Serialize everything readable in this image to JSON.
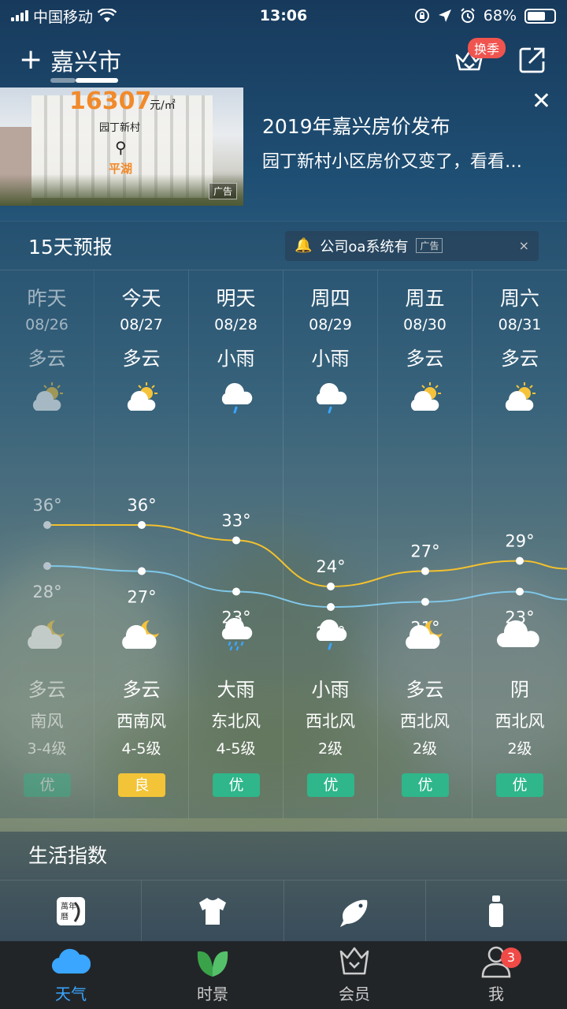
{
  "status_bar": {
    "carrier": "中国移动",
    "time": "13:06",
    "battery": "68%",
    "battery_level": 0.68
  },
  "header": {
    "city": "嘉兴市",
    "season_badge": "换季"
  },
  "ad": {
    "price": "16307",
    "price_unit": "元/㎡",
    "community": "园丁新村",
    "district": "平湖",
    "tag": "广告",
    "title": "2019年嘉兴房价发布",
    "subtitle": "园丁新村小区房价又变了，看看…"
  },
  "forecast": {
    "title": "15天预报",
    "ad_text": "公司oa系统有",
    "ad_tag": "广告",
    "days": [
      {
        "name": "昨天",
        "date": "08/26",
        "day_cond": "多云",
        "high": "36°",
        "low": "28°",
        "night_cond": "多云",
        "wind": "南风",
        "wind_level": "3-4级",
        "aqi": "优",
        "day_icon": "partly-cloudy-day-icon",
        "night_icon": "partly-cloudy-night-icon"
      },
      {
        "name": "今天",
        "date": "08/27",
        "day_cond": "多云",
        "high": "36°",
        "low": "27°",
        "night_cond": "多云",
        "wind": "西南风",
        "wind_level": "4-5级",
        "aqi": "良",
        "day_icon": "partly-cloudy-day-icon",
        "night_icon": "partly-cloudy-night-icon"
      },
      {
        "name": "明天",
        "date": "08/28",
        "day_cond": "小雨",
        "high": "33°",
        "low": "23°",
        "night_cond": "大雨",
        "wind": "东北风",
        "wind_level": "4-5级",
        "aqi": "优",
        "day_icon": "light-rain-icon",
        "night_icon": "heavy-rain-icon"
      },
      {
        "name": "周四",
        "date": "08/29",
        "day_cond": "小雨",
        "high": "24°",
        "low": "20°",
        "night_cond": "小雨",
        "wind": "西北风",
        "wind_level": "2级",
        "aqi": "优",
        "day_icon": "light-rain-icon",
        "night_icon": "light-rain-icon"
      },
      {
        "name": "周五",
        "date": "08/30",
        "day_cond": "多云",
        "high": "27°",
        "low": "21°",
        "night_cond": "多云",
        "wind": "西北风",
        "wind_level": "2级",
        "aqi": "优",
        "day_icon": "partly-cloudy-day-icon",
        "night_icon": "partly-cloudy-night-icon"
      },
      {
        "name": "周六",
        "date": "08/31",
        "day_cond": "多云",
        "high": "29°",
        "low": "23°",
        "night_cond": "阴",
        "wind": "西北风",
        "wind_level": "2级",
        "aqi": "优",
        "day_icon": "partly-cloudy-day-icon",
        "night_icon": "overcast-icon"
      }
    ],
    "highs": [
      36,
      36,
      33,
      24,
      27,
      29
    ],
    "lows": [
      28,
      27,
      23,
      20,
      21,
      23
    ],
    "colors": {
      "high_line": "#f2c12e",
      "low_line": "#7fc7e8",
      "aqi_good": "#2fb68a",
      "aqi_moderate": "#f3c437"
    }
  },
  "life_index": {
    "title": "生活指数",
    "items": [
      {
        "icon": "almanac-icon"
      },
      {
        "icon": "clothing-icon"
      },
      {
        "icon": "fishing-icon"
      },
      {
        "icon": "sunscreen-icon"
      }
    ]
  },
  "tabbar": {
    "tabs": [
      {
        "label": "天气",
        "icon": "cloud-icon",
        "active": true
      },
      {
        "label": "时景",
        "icon": "leaf-icon"
      },
      {
        "label": "会员",
        "icon": "crown-basket-icon"
      },
      {
        "label": "我",
        "icon": "user-icon",
        "badge": "3"
      }
    ]
  }
}
